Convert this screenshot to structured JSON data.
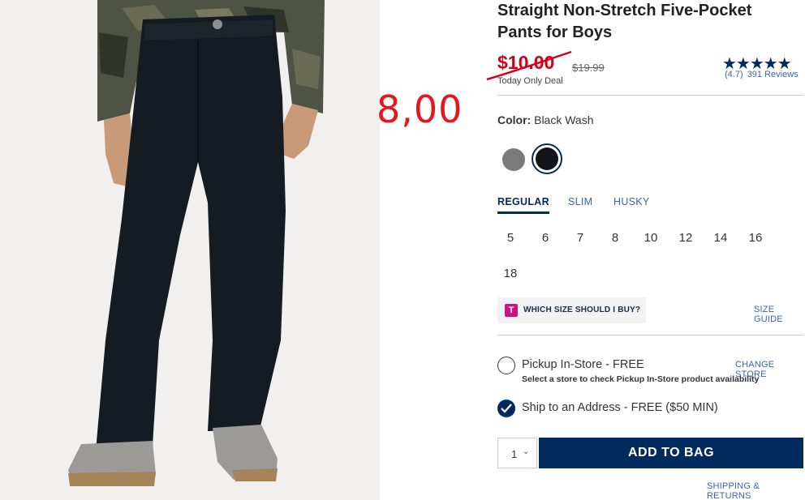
{
  "product": {
    "title_line1": "Straight Non-Stretch Five-Pocket",
    "title_line2": "Pants for Boys",
    "price_now": "$10.00",
    "price_was": "$19.99",
    "deal_label": "Today Only Deal",
    "rating_stars": "★★★★★",
    "rating_value": "(4.7)",
    "review_count": "391 Reviews",
    "rating": 4.7
  },
  "overlay": {
    "handwritten_price": "8,00",
    "color": "#e8151b"
  },
  "color_select": {
    "label": "Color:",
    "value": "Black Wash",
    "swatches": [
      {
        "name": "gray-swatch",
        "color": "#7a7a7b",
        "selected": false
      },
      {
        "name": "black-wash-swatch",
        "color": "#12151a",
        "selected": true
      }
    ]
  },
  "fit_tabs": {
    "regular": "REGULAR",
    "slim": "SLIM",
    "husky": "HUSKY",
    "active": "REGULAR"
  },
  "sizes": [
    "5",
    "6",
    "7",
    "8",
    "10",
    "12",
    "14",
    "16",
    "18"
  ],
  "size_help": {
    "badge": "T",
    "text": "WHICH SIZE SHOULD I BUY?",
    "guide_link": "SIZE GUIDE"
  },
  "fulfillment": {
    "pickup_title": "Pickup In-Store - FREE",
    "pickup_sub": "Select a store to check Pickup In-Store product availability",
    "change_store": "CHANGE STORE",
    "ship_title": "Ship to an Address - FREE ($50 MIN)",
    "selected": "ship"
  },
  "cart": {
    "quantity": "1",
    "add_to_bag": "ADD TO BAG",
    "shipping_returns": "SHIPPING & RETURNS"
  },
  "colors": {
    "brand_navy": "#002b5c",
    "sale_red": "#d0021b",
    "link_blue": "#3a64a8"
  }
}
